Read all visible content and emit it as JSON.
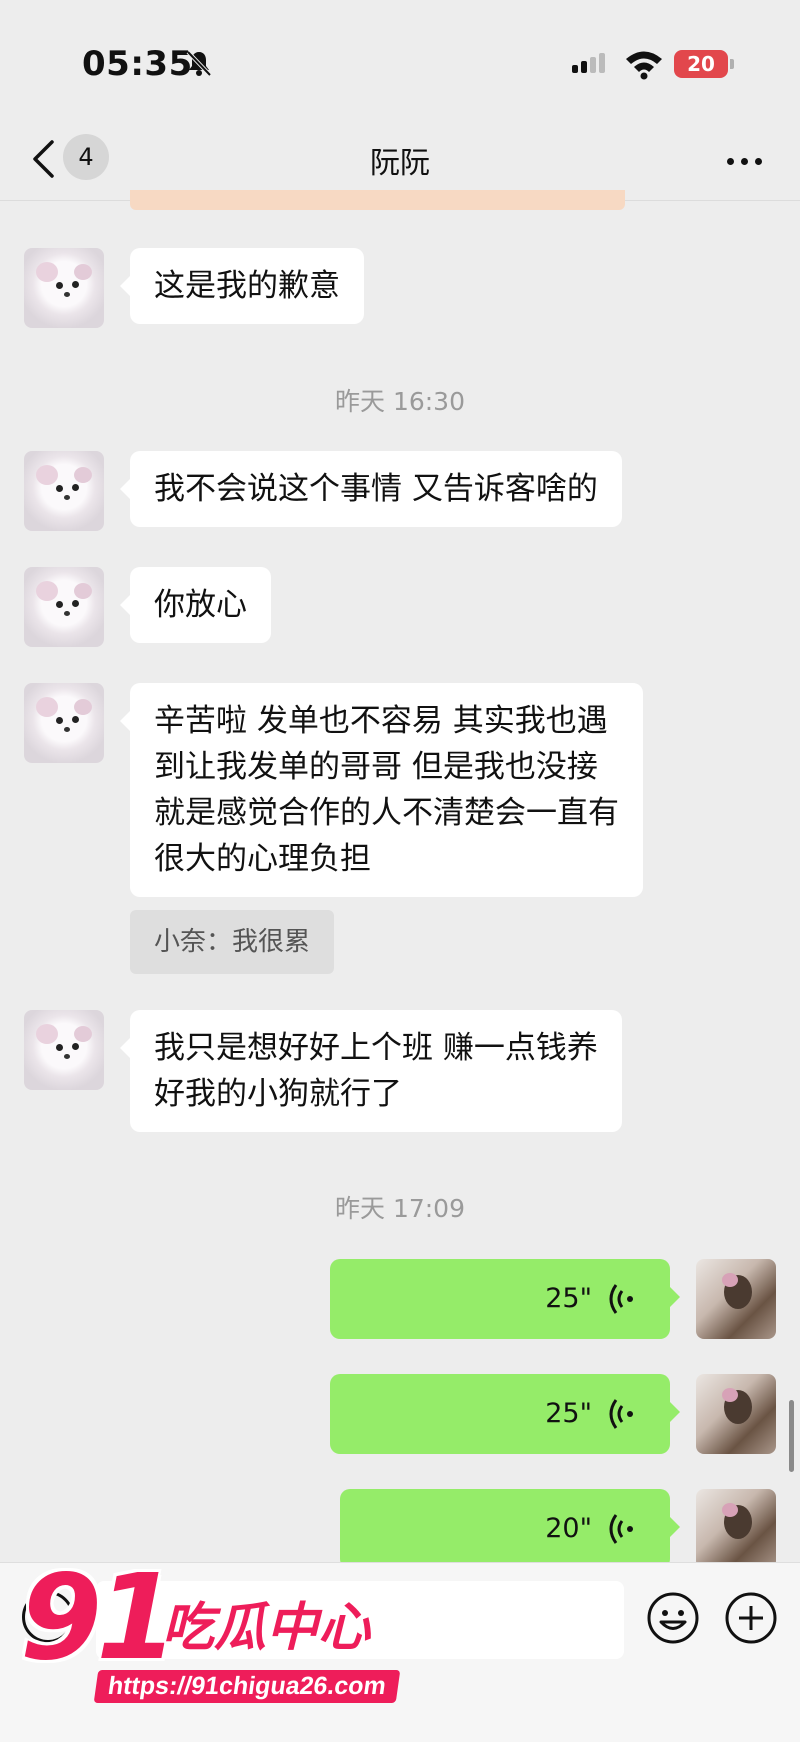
{
  "status_bar": {
    "time": "05:35",
    "battery": "20"
  },
  "nav": {
    "unread_count": "4",
    "title": "阮阮"
  },
  "messages": {
    "m1": "这是我的歉意",
    "ts1": "昨天 16:30",
    "m2": "我不会说这个事情 又告诉客啥的",
    "m3": "你放心",
    "m4_l1": "辛苦啦 发单也不容易 其实我也遇",
    "m4_l2": "到让我发单的哥哥 但是我也没接",
    "m4_l3": "就是感觉合作的人不清楚会一直有",
    "m4_l4": "很大的心理负担",
    "quote": "小奈：我很累",
    "m5_l1": "我只是想好好上个班 赚一点钱养",
    "m5_l2": "好我的小狗就行了",
    "ts2": "昨天 17:09",
    "voice1": "25\"",
    "voice2": "25\"",
    "voice3": "20\""
  },
  "watermark": {
    "number": "91",
    "text": "吃瓜中心",
    "url": "https://91chigua26.com"
  },
  "colors": {
    "background": "#ededed",
    "outgoing_bubble": "#95ec69",
    "incoming_bubble": "#ffffff",
    "battery": "#e2474c",
    "watermark": "#ee1d5a"
  }
}
